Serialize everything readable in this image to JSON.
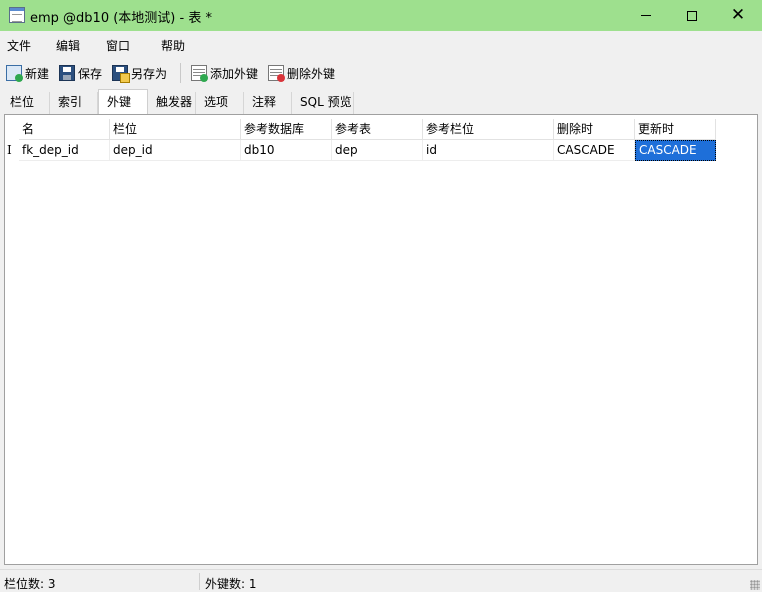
{
  "window": {
    "title": "emp @db10 (本地测试) - 表 *"
  },
  "menu": [
    "文件",
    "编辑",
    "窗口",
    "帮助"
  ],
  "toolbar": {
    "new_label": "新建",
    "save_label": "保存",
    "saveas_label": "另存为",
    "add_fk_label": "添加外键",
    "delete_fk_label": "删除外键"
  },
  "tabs": [
    {
      "label": "栏位"
    },
    {
      "label": "索引"
    },
    {
      "label": "外键",
      "active": true
    },
    {
      "label": "触发器"
    },
    {
      "label": "选项"
    },
    {
      "label": "注释"
    },
    {
      "label": "SQL 预览"
    }
  ],
  "grid": {
    "columns": [
      "名",
      "栏位",
      "参考数据库",
      "参考表",
      "参考栏位",
      "删除时",
      "更新时"
    ],
    "rows": [
      [
        "fk_dep_id",
        "dep_id",
        "db10",
        "dep",
        "id",
        "CASCADE",
        "CASCADE"
      ]
    ],
    "row_indicator": "I",
    "selected_cell": {
      "row": 0,
      "col": 6
    }
  },
  "status": {
    "columns_count": "栏位数: 3",
    "fk_count": "外键数: 1"
  },
  "colors": {
    "titlebar": "#9ee08e",
    "selection": "#1e6fd9"
  }
}
